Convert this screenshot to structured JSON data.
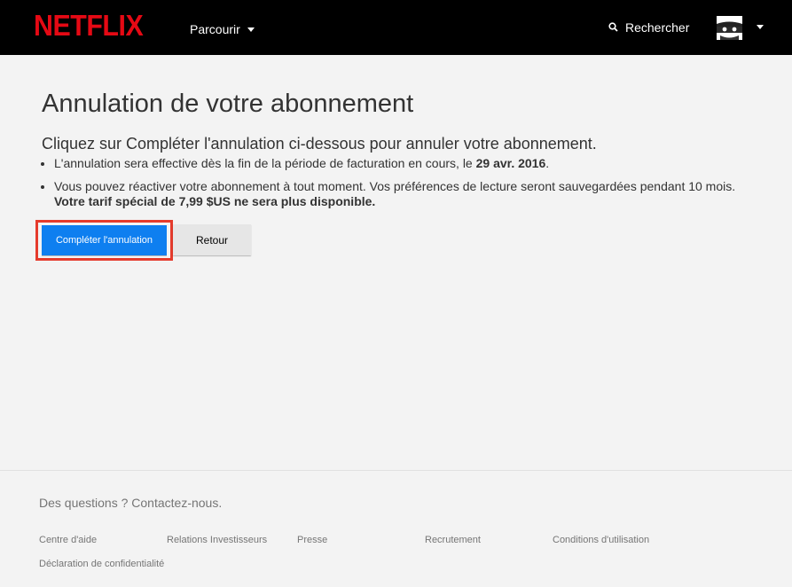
{
  "header": {
    "logo_text": "NETFLIX",
    "browse_label": "Parcourir",
    "search_label": "Rechercher",
    "brand_color": "#e50914"
  },
  "main": {
    "title": "Annulation de votre abonnement",
    "lead": "Cliquez sur Compléter l'annulation ci-dessous pour annuler votre abonnement.",
    "bullet1_text": "L'annulation sera effective dès la fin de la période de facturation en cours, le ",
    "bullet1_date": "29 avr. 2016",
    "bullet1_end": ".",
    "bullet2_text": "Vous pouvez réactiver votre abonnement à tout moment. Vos préférences de lecture seront sauvegardées pendant 10 mois. ",
    "bullet2_bold": "Votre tarif spécial de 7,99 $US ne sera plus disponible.",
    "complete_button": "Compléter l'annulation",
    "back_button": "Retour",
    "primary_color": "#0e7ff0",
    "highlight_color": "#e53b2c"
  },
  "footer": {
    "question": "Des questions ? Contactez-nous.",
    "links": {
      "help": "Centre d'aide",
      "investors": "Relations Investisseurs",
      "press": "Presse",
      "jobs": "Recrutement",
      "terms": "Conditions d'utilisation",
      "privacy": "Déclaration de confidentialité"
    }
  }
}
